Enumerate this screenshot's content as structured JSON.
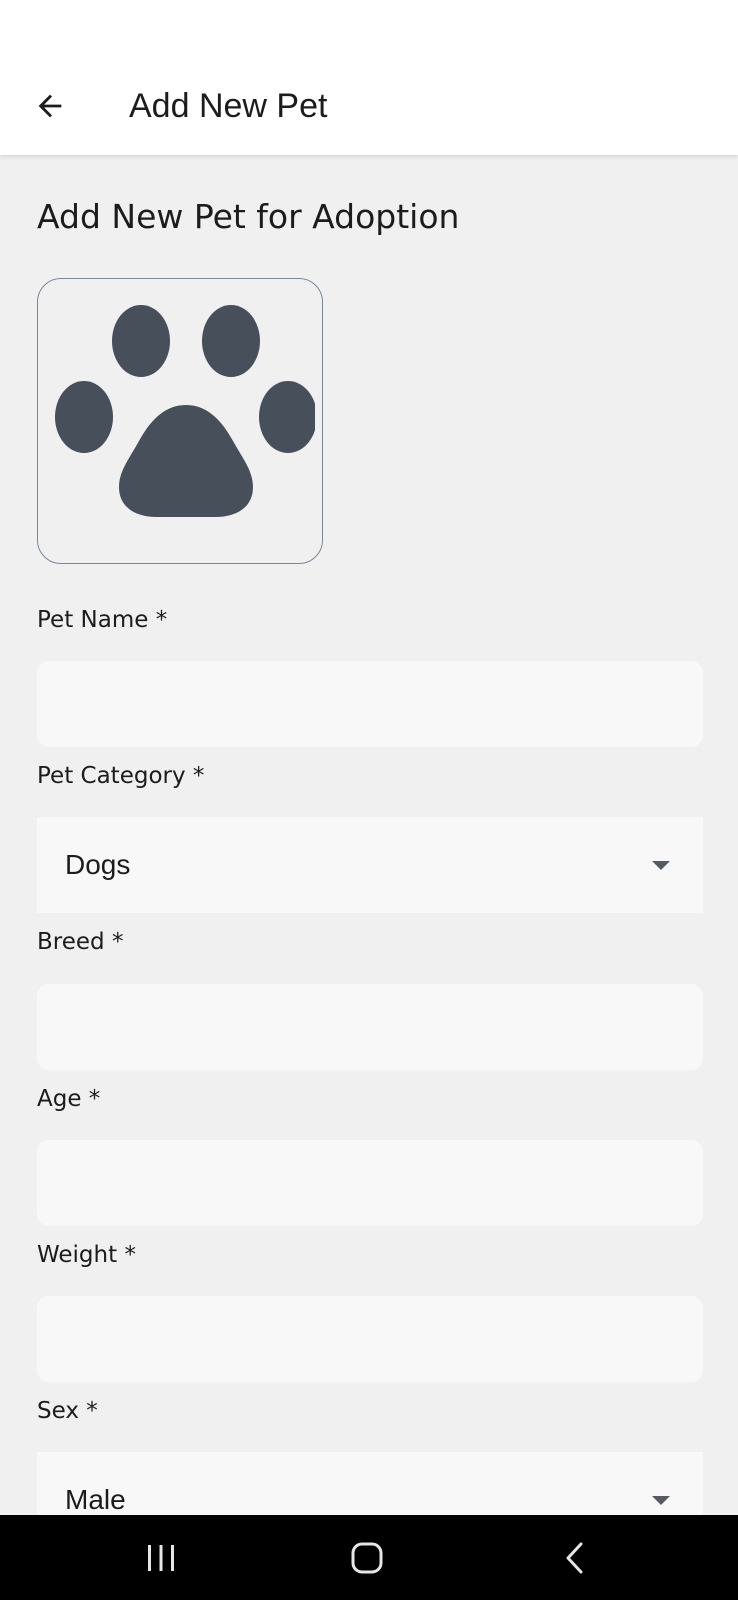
{
  "appbar": {
    "title": "Add New Pet",
    "back_icon": "arrow-left-icon"
  },
  "page": {
    "heading": "Add New Pet for Adoption",
    "photo_icon": "paw-icon",
    "icon_color": "#474f5a"
  },
  "form": {
    "pet_name": {
      "label": "Pet Name *",
      "value": ""
    },
    "pet_category": {
      "label": "Pet Category *",
      "value": "Dogs"
    },
    "breed": {
      "label": "Breed *",
      "value": ""
    },
    "age": {
      "label": "Age *",
      "value": ""
    },
    "weight": {
      "label": "Weight *",
      "value": ""
    },
    "sex": {
      "label": "Sex *",
      "value": "Male"
    }
  },
  "navbar": {
    "recents_icon": "recents-icon",
    "home_icon": "home-icon",
    "back_icon": "nav-back-icon"
  }
}
